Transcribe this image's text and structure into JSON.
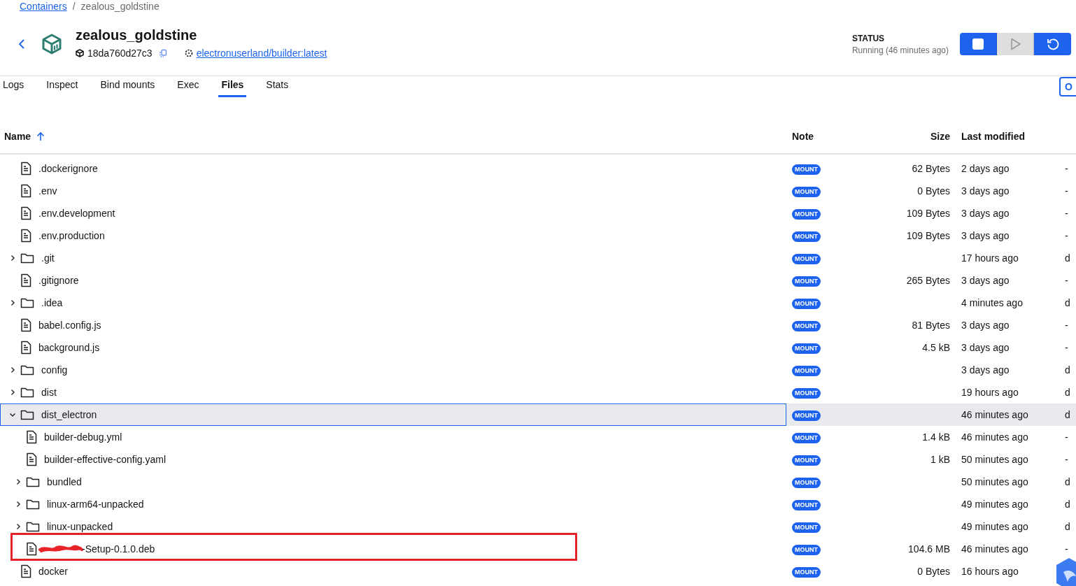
{
  "breadcrumb": {
    "separator": "/",
    "items": [
      {
        "label": "Containers",
        "kind": "link"
      },
      {
        "label": "zealous_goldstine",
        "kind": "current"
      }
    ]
  },
  "container": {
    "name": "zealous_goldstine",
    "id": "18da760d27c3",
    "image": "electronuserland/builder:latest"
  },
  "status": {
    "label": "STATUS",
    "value": "Running (46 minutes ago)"
  },
  "actions": [
    {
      "kind": "stop",
      "disabled": false
    },
    {
      "kind": "start",
      "disabled": true
    },
    {
      "kind": "restart",
      "disabled": false
    }
  ],
  "tabs": [
    {
      "label": "Logs",
      "selected": false
    },
    {
      "label": "Inspect",
      "selected": false
    },
    {
      "label": "Bind mounts",
      "selected": false
    },
    {
      "label": "Exec",
      "selected": false
    },
    {
      "label": "Files",
      "selected": true
    },
    {
      "label": "Stats",
      "selected": false
    }
  ],
  "side_button": {
    "label": "O"
  },
  "table": {
    "columns": [
      {
        "label": "Name",
        "sorted": true
      },
      {
        "label": "Note",
        "sorted": false
      },
      {
        "label": "Size",
        "sorted": false
      },
      {
        "label": "Last modified",
        "sorted": false
      }
    ],
    "rows": [
      {
        "name": ".dockerignore",
        "kind": "file",
        "note": "MOUNT",
        "size": "62 Bytes",
        "modified": "2 days ago",
        "column_5": "-",
        "selected": false,
        "highlighted": false,
        "redacted": false
      },
      {
        "name": ".env",
        "kind": "file",
        "note": "MOUNT",
        "size": "0 Bytes",
        "modified": "3 days ago",
        "column_5": "-",
        "selected": false,
        "highlighted": false,
        "redacted": false
      },
      {
        "name": ".env.development",
        "kind": "file",
        "note": "MOUNT",
        "size": "109 Bytes",
        "modified": "3 days ago",
        "column_5": "-",
        "selected": false,
        "highlighted": false,
        "redacted": false
      },
      {
        "name": ".env.production",
        "kind": "file",
        "note": "MOUNT",
        "size": "109 Bytes",
        "modified": "3 days ago",
        "column_5": "-",
        "selected": false,
        "highlighted": false,
        "redacted": false
      },
      {
        "name": ".git",
        "kind": "folder",
        "expanded": false,
        "note": "MOUNT",
        "modified": "17 hours ago",
        "column_5": "d",
        "selected": false,
        "highlighted": false,
        "redacted": false
      },
      {
        "name": ".gitignore",
        "kind": "file",
        "note": "MOUNT",
        "size": "265 Bytes",
        "modified": "3 days ago",
        "column_5": "-",
        "selected": false,
        "highlighted": false,
        "redacted": false
      },
      {
        "name": ".idea",
        "kind": "folder",
        "expanded": false,
        "note": "MOUNT",
        "modified": "4 minutes ago",
        "column_5": "d",
        "selected": false,
        "highlighted": false,
        "redacted": false
      },
      {
        "name": "babel.config.js",
        "kind": "file",
        "note": "MOUNT",
        "size": "81 Bytes",
        "modified": "3 days ago",
        "column_5": "-",
        "selected": false,
        "highlighted": false,
        "redacted": false
      },
      {
        "name": "background.js",
        "kind": "file",
        "note": "MOUNT",
        "size": "4.5 kB",
        "modified": "3 days ago",
        "column_5": "-",
        "selected": false,
        "highlighted": false,
        "redacted": false
      },
      {
        "name": "config",
        "kind": "folder",
        "expanded": false,
        "note": "MOUNT",
        "modified": "3 days ago",
        "column_5": "d",
        "selected": false,
        "highlighted": false,
        "redacted": false
      },
      {
        "name": "dist",
        "kind": "folder",
        "expanded": false,
        "note": "MOUNT",
        "modified": "19 hours ago",
        "column_5": "d",
        "selected": false,
        "highlighted": false,
        "redacted": false
      },
      {
        "name": "dist_electron",
        "kind": "folder",
        "expanded": true,
        "note": "MOUNT",
        "modified": "46 minutes ago",
        "column_5": "d",
        "selected": true,
        "highlighted": false,
        "redacted": false,
        "children": [
          {
            "name": "builder-debug.yml",
            "kind": "file",
            "note": "MOUNT",
            "size": "1.4 kB",
            "modified": "46 minutes ago",
            "column_5": "-",
            "selected": false,
            "highlighted": false,
            "redacted": false
          },
          {
            "name": "builder-effective-config.yaml",
            "kind": "file",
            "note": "MOUNT",
            "size": "1 kB",
            "modified": "50 minutes ago",
            "column_5": "-",
            "selected": false,
            "highlighted": false,
            "redacted": false
          },
          {
            "name": "bundled",
            "kind": "folder",
            "expanded": false,
            "note": "MOUNT",
            "modified": "50 minutes ago",
            "column_5": "d",
            "selected": false,
            "highlighted": false,
            "redacted": false
          },
          {
            "name": "linux-arm64-unpacked",
            "kind": "folder",
            "expanded": false,
            "note": "MOUNT",
            "modified": "49 minutes ago",
            "column_5": "d",
            "selected": false,
            "highlighted": false,
            "redacted": false
          },
          {
            "name": "linux-unpacked",
            "kind": "folder",
            "expanded": false,
            "note": "MOUNT",
            "modified": "49 minutes ago",
            "column_5": "d",
            "selected": false,
            "highlighted": false,
            "redacted": false
          },
          {
            "name": "-Setup-0.1.0.deb",
            "kind": "file",
            "note": "MOUNT",
            "size": "104.6 MB",
            "modified": "46 minutes ago",
            "column_5": "-",
            "selected": false,
            "highlighted": true,
            "redacted": true
          }
        ]
      },
      {
        "name": "docker",
        "kind": "file",
        "note": "MOUNT",
        "size": "0 Bytes",
        "modified": "16 hours ago",
        "selected": false,
        "highlighted": false,
        "redacted": false
      }
    ]
  }
}
